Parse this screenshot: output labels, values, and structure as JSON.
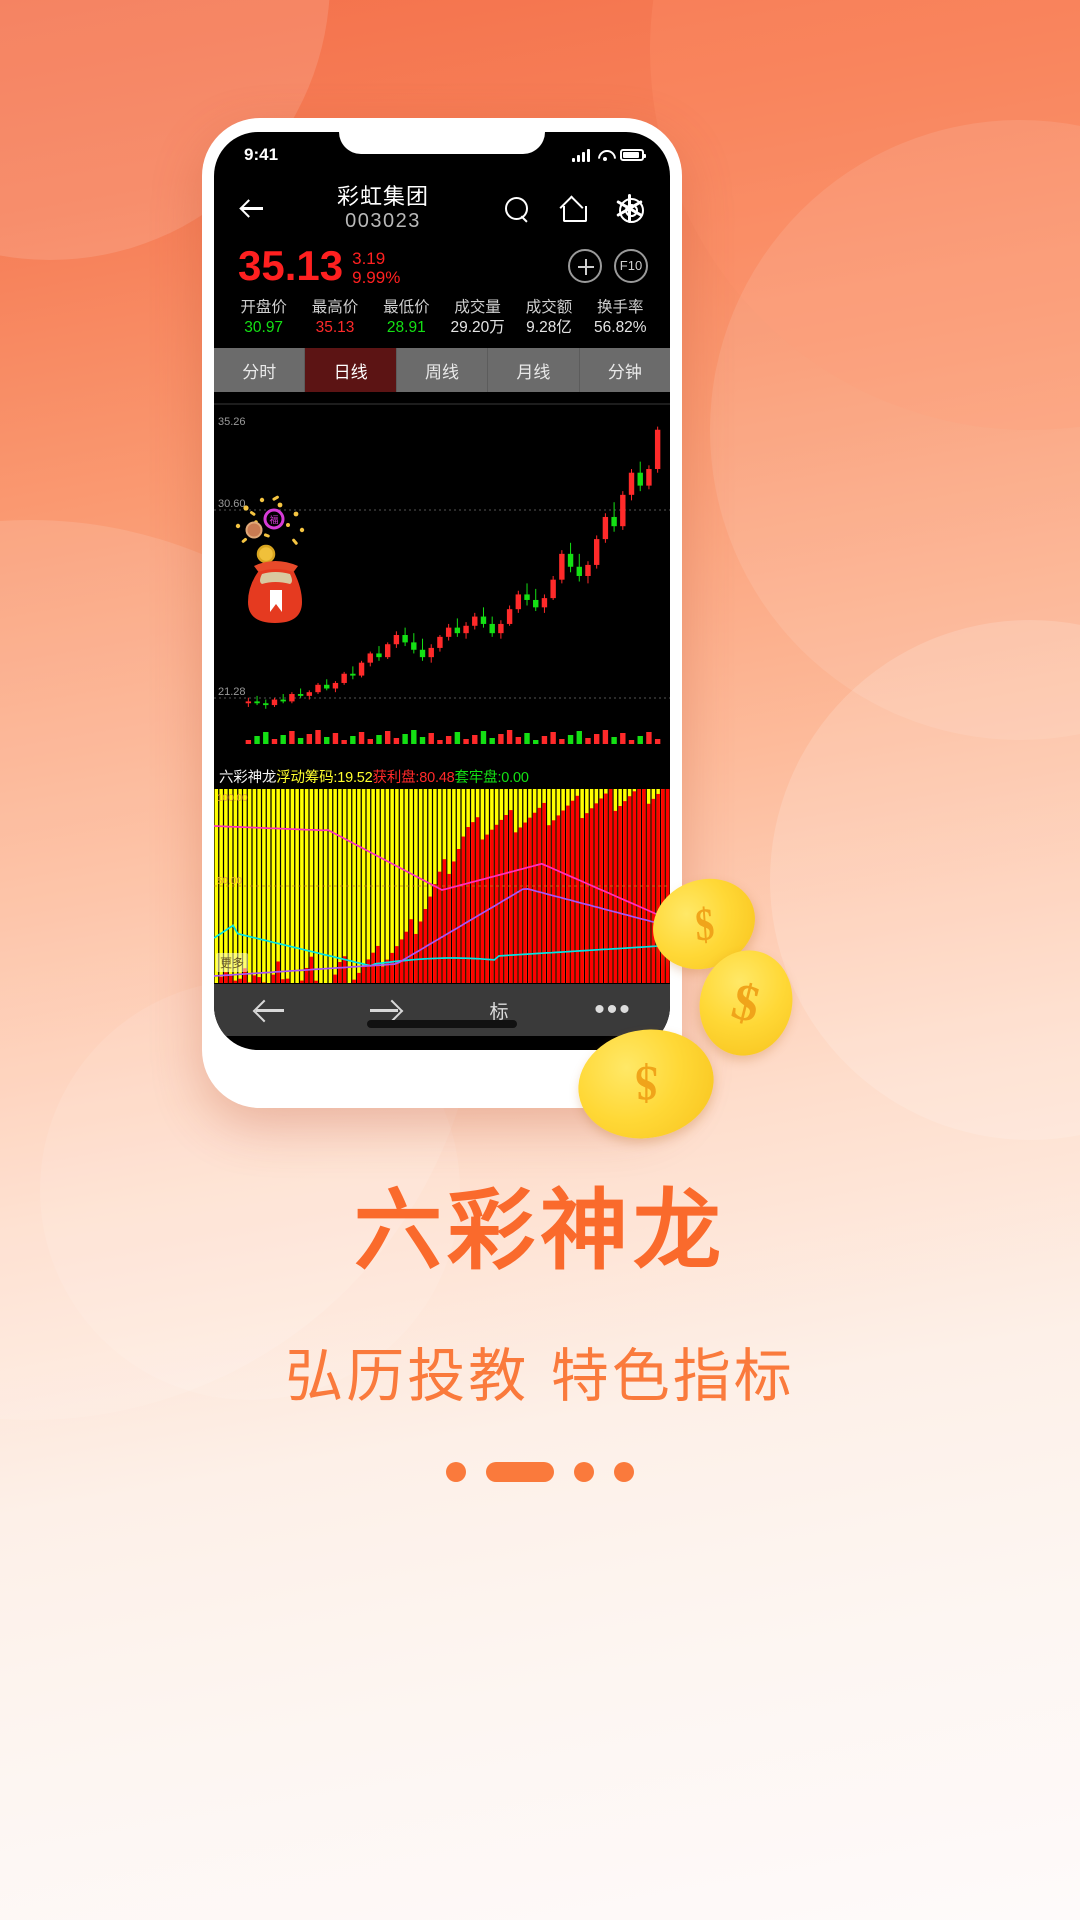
{
  "statusbar": {
    "time": "9:41"
  },
  "header": {
    "back_icon": "arrow-left-icon",
    "stock_name": "彩虹集团",
    "stock_code": "003023",
    "search_icon": "search-icon",
    "home_icon": "home-icon",
    "settings_icon": "gear-icon"
  },
  "quote": {
    "last_price": "35.13",
    "change_abs": "3.19",
    "change_pct": "9.99%",
    "add_label": "＋",
    "f10_label": "F10",
    "up_color": "#ff2020",
    "down_color": "#14e014"
  },
  "stats": [
    {
      "label": "开盘价",
      "value": "30.97",
      "tone": "v-green"
    },
    {
      "label": "最高价",
      "value": "35.13",
      "tone": "v-red"
    },
    {
      "label": "最低价",
      "value": "28.91",
      "tone": "v-green"
    },
    {
      "label": "成交量",
      "value": "29.20万",
      "tone": "v-white"
    },
    {
      "label": "成交额",
      "value": "9.28亿",
      "tone": "v-white"
    },
    {
      "label": "换手率",
      "value": "56.82%",
      "tone": "v-white"
    }
  ],
  "tabs": [
    {
      "label": "分时",
      "active": false
    },
    {
      "label": "日线",
      "active": true
    },
    {
      "label": "周线",
      "active": false
    },
    {
      "label": "月线",
      "active": false
    },
    {
      "label": "分钟",
      "active": false
    }
  ],
  "indicator": {
    "name": "六彩神龙",
    "floating_label": "浮动筹码:19.52",
    "profit_label": "获利盘:80.48",
    "trapped_label": "套牢盘:0.00",
    "more_label": "更多",
    "more_value": "0.00"
  },
  "bottom_nav": {
    "prev_icon": "arrow-left-icon",
    "next_icon": "arrow-right-icon",
    "mark_label": "标",
    "more_icon": "ellipsis-icon"
  },
  "promo": {
    "title": "六彩神龙",
    "subtitle": "弘历投教 特色指标",
    "accent_color": "#fa6a2c"
  },
  "pager": {
    "count": 4,
    "active_index": 1
  },
  "coins": [
    {
      "symbol": "$"
    },
    {
      "symbol": "$"
    },
    {
      "symbol": "$"
    }
  ],
  "chart_data": {
    "type": "candlestick",
    "title": "彩虹集团 003023 日线",
    "y_ticks": [
      "35.26",
      "30.60",
      "21.28"
    ],
    "y_tick_values": [
      35.26,
      30.6,
      21.28
    ],
    "ylim": [
      19.5,
      36.2
    ],
    "grid": true,
    "up_color": "#ff2a2a",
    "down_color": "#14e014",
    "candles": [
      {
        "o": 20.3,
        "h": 20.6,
        "l": 20.1,
        "c": 20.4,
        "dir": "up"
      },
      {
        "o": 20.4,
        "h": 20.7,
        "l": 20.2,
        "c": 20.3,
        "dir": "down"
      },
      {
        "o": 20.3,
        "h": 20.5,
        "l": 20.0,
        "c": 20.2,
        "dir": "down"
      },
      {
        "o": 20.2,
        "h": 20.6,
        "l": 20.1,
        "c": 20.5,
        "dir": "up"
      },
      {
        "o": 20.5,
        "h": 20.8,
        "l": 20.3,
        "c": 20.4,
        "dir": "down"
      },
      {
        "o": 20.4,
        "h": 20.9,
        "l": 20.3,
        "c": 20.8,
        "dir": "up"
      },
      {
        "o": 20.8,
        "h": 21.1,
        "l": 20.6,
        "c": 20.7,
        "dir": "down"
      },
      {
        "o": 20.7,
        "h": 21.0,
        "l": 20.5,
        "c": 20.9,
        "dir": "up"
      },
      {
        "o": 20.9,
        "h": 21.4,
        "l": 20.8,
        "c": 21.3,
        "dir": "up"
      },
      {
        "o": 21.3,
        "h": 21.6,
        "l": 21.0,
        "c": 21.1,
        "dir": "down"
      },
      {
        "o": 21.1,
        "h": 21.5,
        "l": 20.9,
        "c": 21.4,
        "dir": "up"
      },
      {
        "o": 21.4,
        "h": 22.0,
        "l": 21.3,
        "c": 21.9,
        "dir": "up"
      },
      {
        "o": 21.9,
        "h": 22.3,
        "l": 21.6,
        "c": 21.8,
        "dir": "down"
      },
      {
        "o": 21.8,
        "h": 22.6,
        "l": 21.7,
        "c": 22.5,
        "dir": "up"
      },
      {
        "o": 22.5,
        "h": 23.1,
        "l": 22.3,
        "c": 23.0,
        "dir": "up"
      },
      {
        "o": 23.0,
        "h": 23.4,
        "l": 22.6,
        "c": 22.8,
        "dir": "down"
      },
      {
        "o": 22.8,
        "h": 23.6,
        "l": 22.7,
        "c": 23.5,
        "dir": "up"
      },
      {
        "o": 23.5,
        "h": 24.2,
        "l": 23.3,
        "c": 24.0,
        "dir": "up"
      },
      {
        "o": 24.0,
        "h": 24.4,
        "l": 23.4,
        "c": 23.6,
        "dir": "down"
      },
      {
        "o": 23.6,
        "h": 24.1,
        "l": 23.0,
        "c": 23.2,
        "dir": "down"
      },
      {
        "o": 23.2,
        "h": 23.8,
        "l": 22.6,
        "c": 22.8,
        "dir": "down"
      },
      {
        "o": 22.8,
        "h": 23.5,
        "l": 22.5,
        "c": 23.3,
        "dir": "up"
      },
      {
        "o": 23.3,
        "h": 24.0,
        "l": 23.1,
        "c": 23.9,
        "dir": "up"
      },
      {
        "o": 23.9,
        "h": 24.6,
        "l": 23.7,
        "c": 24.4,
        "dir": "up"
      },
      {
        "o": 24.4,
        "h": 24.9,
        "l": 23.9,
        "c": 24.1,
        "dir": "down"
      },
      {
        "o": 24.1,
        "h": 24.7,
        "l": 23.8,
        "c": 24.5,
        "dir": "up"
      },
      {
        "o": 24.5,
        "h": 25.2,
        "l": 24.3,
        "c": 25.0,
        "dir": "up"
      },
      {
        "o": 25.0,
        "h": 25.5,
        "l": 24.4,
        "c": 24.6,
        "dir": "down"
      },
      {
        "o": 24.6,
        "h": 25.0,
        "l": 23.9,
        "c": 24.1,
        "dir": "down"
      },
      {
        "o": 24.1,
        "h": 24.8,
        "l": 23.8,
        "c": 24.6,
        "dir": "up"
      },
      {
        "o": 24.6,
        "h": 25.6,
        "l": 24.5,
        "c": 25.4,
        "dir": "up"
      },
      {
        "o": 25.4,
        "h": 26.4,
        "l": 25.2,
        "c": 26.2,
        "dir": "up"
      },
      {
        "o": 26.2,
        "h": 26.8,
        "l": 25.6,
        "c": 25.9,
        "dir": "down"
      },
      {
        "o": 25.9,
        "h": 26.5,
        "l": 25.3,
        "c": 25.5,
        "dir": "down"
      },
      {
        "o": 25.5,
        "h": 26.2,
        "l": 25.2,
        "c": 26.0,
        "dir": "up"
      },
      {
        "o": 26.0,
        "h": 27.2,
        "l": 25.9,
        "c": 27.0,
        "dir": "up"
      },
      {
        "o": 27.0,
        "h": 28.6,
        "l": 26.8,
        "c": 28.4,
        "dir": "up"
      },
      {
        "o": 28.4,
        "h": 29.0,
        "l": 27.4,
        "c": 27.7,
        "dir": "down"
      },
      {
        "o": 27.7,
        "h": 28.4,
        "l": 26.9,
        "c": 27.2,
        "dir": "down"
      },
      {
        "o": 27.2,
        "h": 28.0,
        "l": 26.8,
        "c": 27.8,
        "dir": "up"
      },
      {
        "o": 27.8,
        "h": 29.4,
        "l": 27.6,
        "c": 29.2,
        "dir": "up"
      },
      {
        "o": 29.2,
        "h": 30.6,
        "l": 29.0,
        "c": 30.4,
        "dir": "up"
      },
      {
        "o": 30.4,
        "h": 31.2,
        "l": 29.6,
        "c": 29.9,
        "dir": "down"
      },
      {
        "o": 29.9,
        "h": 31.8,
        "l": 29.7,
        "c": 31.6,
        "dir": "up"
      },
      {
        "o": 31.6,
        "h": 33.0,
        "l": 31.3,
        "c": 32.8,
        "dir": "up"
      },
      {
        "o": 32.8,
        "h": 33.4,
        "l": 31.8,
        "c": 32.1,
        "dir": "down"
      },
      {
        "o": 32.1,
        "h": 33.2,
        "l": 31.9,
        "c": 33.0,
        "dir": "up"
      },
      {
        "o": 33.0,
        "h": 35.3,
        "l": 32.8,
        "c": 35.13,
        "dir": "up"
      }
    ],
    "sub_panel": {
      "type": "stacked_bar_with_lines",
      "name": "六彩神龙 浮动筹码",
      "y_ticks": [
        "100.00",
        "50.00",
        "0.00"
      ],
      "bar_colors": {
        "yellow": "#ffff00",
        "red": "#ff0000"
      },
      "line_colors": {
        "cyan": "#00e5e5",
        "magenta": "#ff2fbe",
        "purple": "#a020f0"
      },
      "floating_chips": 19.52,
      "profit_ratio": 80.48,
      "trapped_ratio": 0.0
    }
  }
}
